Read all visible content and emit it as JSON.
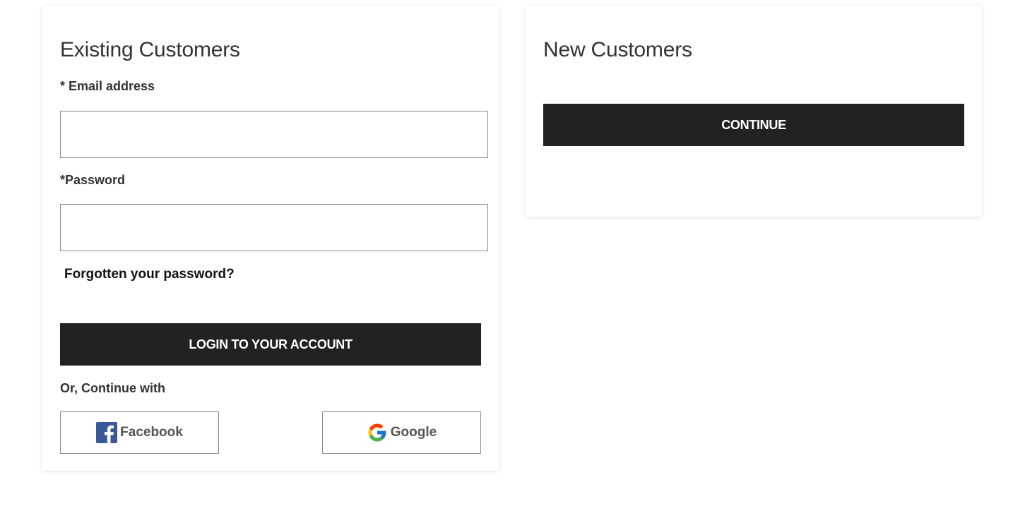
{
  "existing": {
    "title": "Existing Customers",
    "email_label": "* Email address",
    "email_value": "",
    "password_label": "*Password",
    "password_value": "",
    "forgot_label": "Forgotten your password?",
    "login_label": "LOGIN TO YOUR ACCOUNT",
    "or_label": "Or, Continue with",
    "social": {
      "facebook_label": "Facebook",
      "facebook_icon": "facebook-icon",
      "google_label": "Google",
      "google_icon": "google-icon"
    }
  },
  "new_customers": {
    "title": "New Customers",
    "continue_label": "CONTINUE"
  },
  "colors": {
    "button_dark": "#222222",
    "text": "#333333",
    "facebook_blue": "#3b5998",
    "border": "#8a8a8a"
  }
}
